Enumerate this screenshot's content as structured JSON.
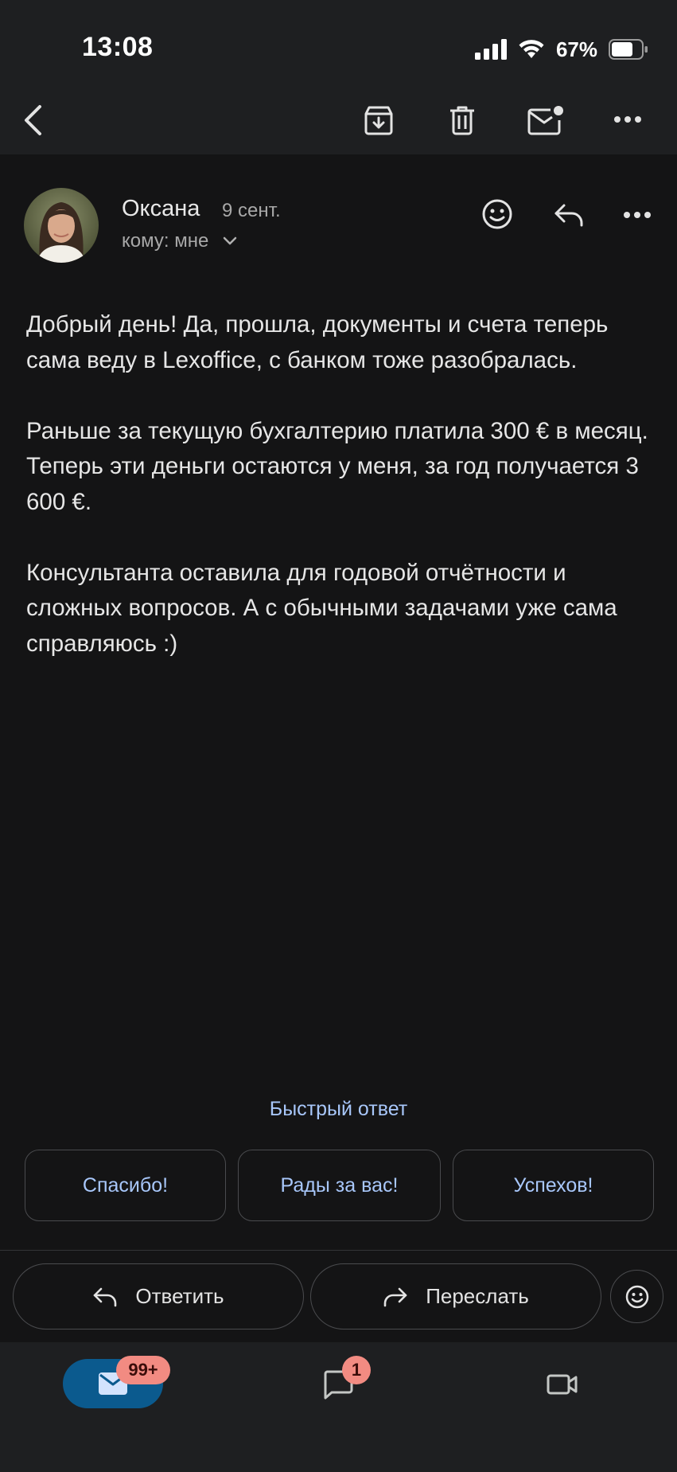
{
  "status_bar": {
    "time": "13:08",
    "battery": "67%"
  },
  "toolbar": {
    "back_icon": "back-arrow-icon",
    "archive_icon": "archive-icon",
    "delete_icon": "trash-icon",
    "unread_icon": "mark-unread-icon",
    "more_icon": "more-horizontal-icon"
  },
  "email": {
    "sender_name": "Оксана",
    "date": "9 сент.",
    "recipient": "кому: мне",
    "body": [
      "Добрый день! Да, прошла, документы и счета теперь сама веду в Lexoffice, с банком тоже разобралась.",
      "Раньше за текущую бухгалтерию платила 300 € в месяц. Теперь эти деньги остаются у меня, за год получается 3 600 €.",
      "Консультанта оставила для годовой отчётности и сложных вопросов. А с обычными задачами уже сама справляюсь :)"
    ]
  },
  "quick_reply": {
    "title": "Быстрый ответ",
    "options": [
      "Спасибо!",
      "Рады за вас!",
      "Успехов!"
    ]
  },
  "actions": {
    "reply_label": "Ответить",
    "forward_label": "Переслать"
  },
  "bottom_nav": {
    "mail_badge": "99+",
    "chat_badge": "1"
  },
  "colors": {
    "accent": "#a8c7fa",
    "background": "#141415",
    "bar": "#1e1f21",
    "badge": "#f28b82",
    "active_nav": "#0b5a8e"
  }
}
